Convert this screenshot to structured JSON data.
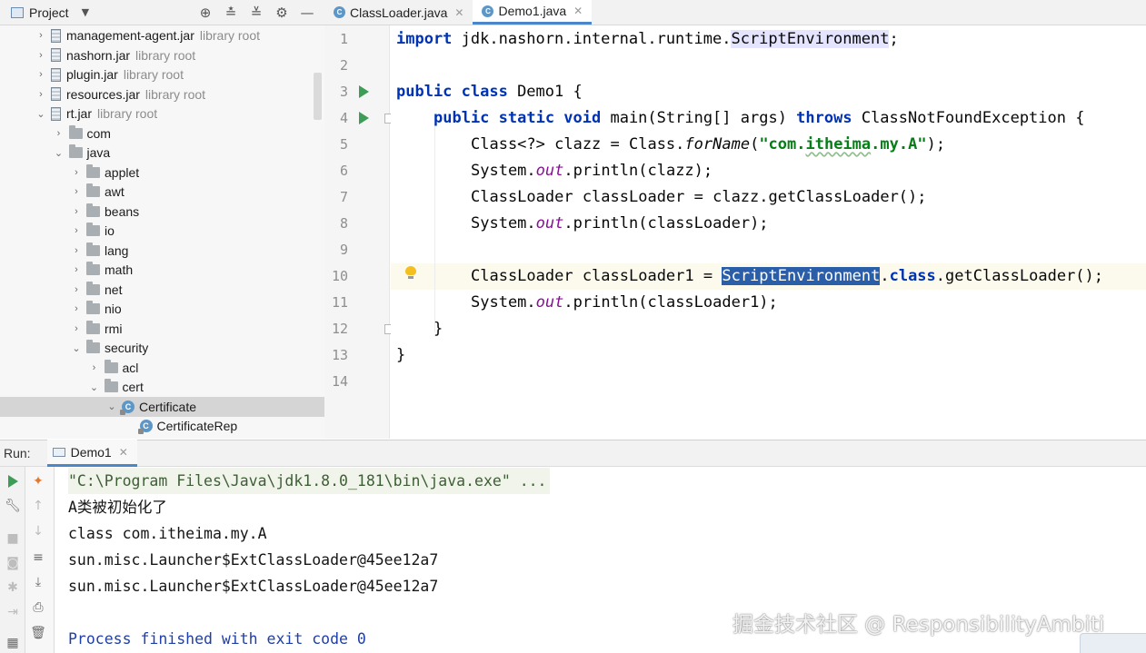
{
  "project_panel": {
    "title": "Project",
    "tree": [
      {
        "name": "management-agent.jar",
        "hint": "library root",
        "type": "jar",
        "depth": 1,
        "arrow": "right"
      },
      {
        "name": "nashorn.jar",
        "hint": "library root",
        "type": "jar",
        "depth": 1,
        "arrow": "right"
      },
      {
        "name": "plugin.jar",
        "hint": "library root",
        "type": "jar",
        "depth": 1,
        "arrow": "right"
      },
      {
        "name": "resources.jar",
        "hint": "library root",
        "type": "jar",
        "depth": 1,
        "arrow": "right"
      },
      {
        "name": "rt.jar",
        "hint": "library root",
        "type": "jar",
        "depth": 1,
        "arrow": "down"
      },
      {
        "name": "com",
        "hint": "",
        "type": "folder",
        "depth": 2,
        "arrow": "right"
      },
      {
        "name": "java",
        "hint": "",
        "type": "folder",
        "depth": 2,
        "arrow": "down"
      },
      {
        "name": "applet",
        "hint": "",
        "type": "folder",
        "depth": 3,
        "arrow": "right"
      },
      {
        "name": "awt",
        "hint": "",
        "type": "folder",
        "depth": 3,
        "arrow": "right"
      },
      {
        "name": "beans",
        "hint": "",
        "type": "folder",
        "depth": 3,
        "arrow": "right"
      },
      {
        "name": "io",
        "hint": "",
        "type": "folder",
        "depth": 3,
        "arrow": "right"
      },
      {
        "name": "lang",
        "hint": "",
        "type": "folder",
        "depth": 3,
        "arrow": "right"
      },
      {
        "name": "math",
        "hint": "",
        "type": "folder",
        "depth": 3,
        "arrow": "right"
      },
      {
        "name": "net",
        "hint": "",
        "type": "folder",
        "depth": 3,
        "arrow": "right"
      },
      {
        "name": "nio",
        "hint": "",
        "type": "folder",
        "depth": 3,
        "arrow": "right"
      },
      {
        "name": "rmi",
        "hint": "",
        "type": "folder",
        "depth": 3,
        "arrow": "right"
      },
      {
        "name": "security",
        "hint": "",
        "type": "folder",
        "depth": 3,
        "arrow": "down"
      },
      {
        "name": "acl",
        "hint": "",
        "type": "folder",
        "depth": 4,
        "arrow": "right"
      },
      {
        "name": "cert",
        "hint": "",
        "type": "folder",
        "depth": 4,
        "arrow": "down"
      },
      {
        "name": "Certificate",
        "hint": "",
        "type": "class",
        "depth": 5,
        "arrow": "down",
        "selected": true
      },
      {
        "name": "CertificateRep",
        "hint": "",
        "type": "class",
        "depth": 6,
        "arrow": "none"
      }
    ]
  },
  "editor": {
    "tabs": [
      {
        "label": "ClassLoader.java",
        "active": false
      },
      {
        "label": "Demo1.java",
        "active": true
      }
    ],
    "line_numbers": [
      "1",
      "2",
      "3",
      "4",
      "5",
      "6",
      "7",
      "8",
      "9",
      "10",
      "11",
      "12",
      "13",
      "14"
    ],
    "code": {
      "l1_kw": "import",
      "l1_pkg": " jdk.nashorn.internal.runtime.",
      "l1_cls": "ScriptEnvironment",
      "l1_end": ";",
      "l3_kw": "public class",
      "l3_rest": " Demo1 {",
      "l4_kw1": "public static void",
      "l4_mid": " main(String[] args) ",
      "l4_kw2": "throws",
      "l4_end": " ClassNotFoundException {",
      "l5_a": "Class<?> clazz = Class.",
      "l5_m": "forName",
      "l5_b": "(",
      "l5_s1": "\"com.",
      "l5_s2": "itheima",
      "l5_s3": ".my.A\"",
      "l5_c": ");",
      "l6_a": "System.",
      "l6_f": "out",
      "l6_b": ".println(clazz);",
      "l7": "ClassLoader classLoader = clazz.getClassLoader();",
      "l8_a": "System.",
      "l8_f": "out",
      "l8_b": ".println(classLoader);",
      "l10_a": "ClassLoader classLoader1 = ",
      "l10_sel": "ScriptEnvironment",
      "l10_dot": ".",
      "l10_kw": "class",
      "l10_b": ".getClassLoader();",
      "l11_a": "System.",
      "l11_f": "out",
      "l11_b": ".println(classLoader1);",
      "l12": "}",
      "l13": "}"
    }
  },
  "run_panel": {
    "label": "Run:",
    "tab": "Demo1",
    "console": [
      "\"C:\\Program Files\\Java\\jdk1.8.0_181\\bin\\java.exe\" ...",
      "A类被初始化了",
      "class com.itheima.my.A",
      "sun.misc.Launcher$ExtClassLoader@45ee12a7",
      "sun.misc.Launcher$ExtClassLoader@45ee12a7",
      "",
      "Process finished with exit code 0"
    ]
  },
  "watermark": "掘金技术社区 @ ResponsibilityAmbiti",
  "colors": {
    "keyword": "#0033b3",
    "string": "#067d17",
    "field": "#871094",
    "selection": "#2b5ea8",
    "run_green": "#3d9c56",
    "tab_accent": "#4a86c8"
  }
}
